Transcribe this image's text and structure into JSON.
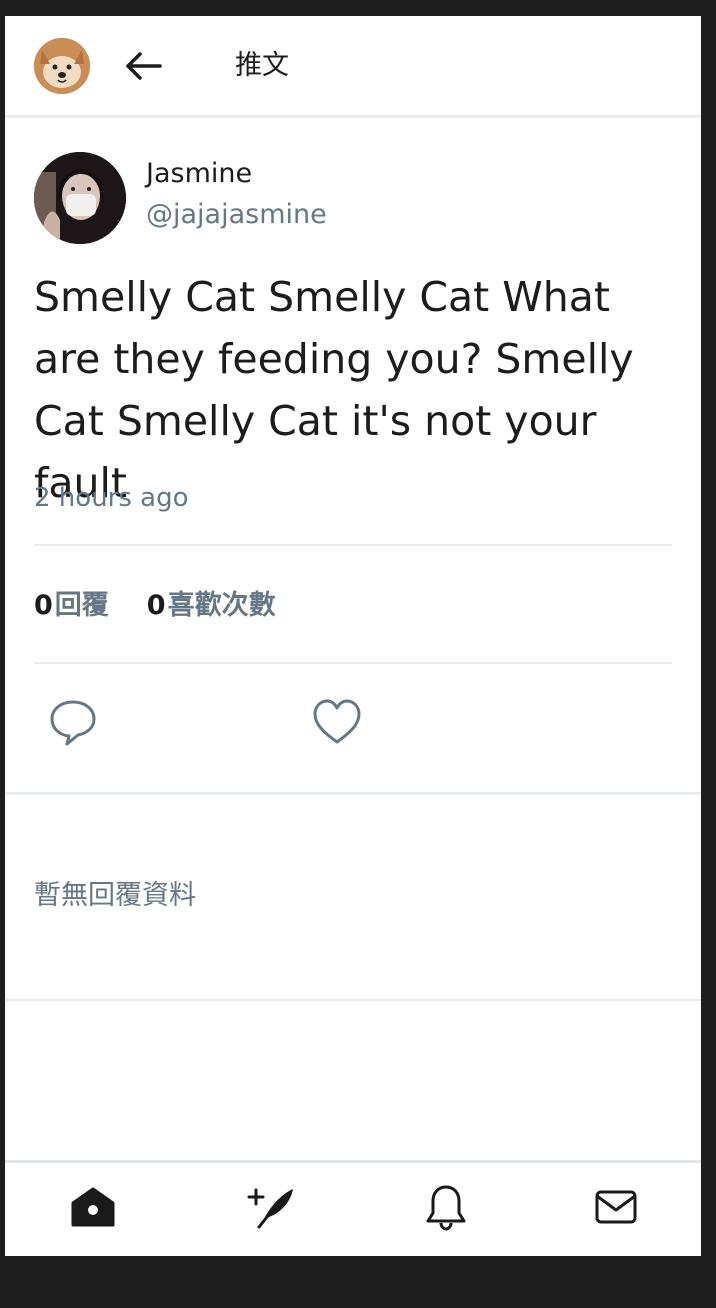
{
  "header": {
    "title": "推文",
    "avatar_icon": "shiba-dog-avatar",
    "back_icon": "arrow-left-icon"
  },
  "tweet": {
    "author_name": "Jasmine",
    "author_handle": "@jajajasmine",
    "text": "Smelly Cat Smelly Cat What are they feeding you? Smelly Cat Smelly Cat it's not your fault",
    "time": "2 hours ago",
    "reply_count": "0",
    "reply_label": "回覆",
    "like_count": "0",
    "like_label": "喜歡次數",
    "actions": [
      "reply-icon",
      "heart-icon"
    ]
  },
  "replies": {
    "empty_message": "暫無回覆資料"
  },
  "bottom_nav": {
    "items": [
      "home-icon",
      "compose-tweet-icon",
      "bell-icon",
      "mail-icon"
    ]
  },
  "colors": {
    "text": "#1c1c1c",
    "secondary": "#657786",
    "divider": "#e8ecef",
    "background": "#ffffff"
  }
}
